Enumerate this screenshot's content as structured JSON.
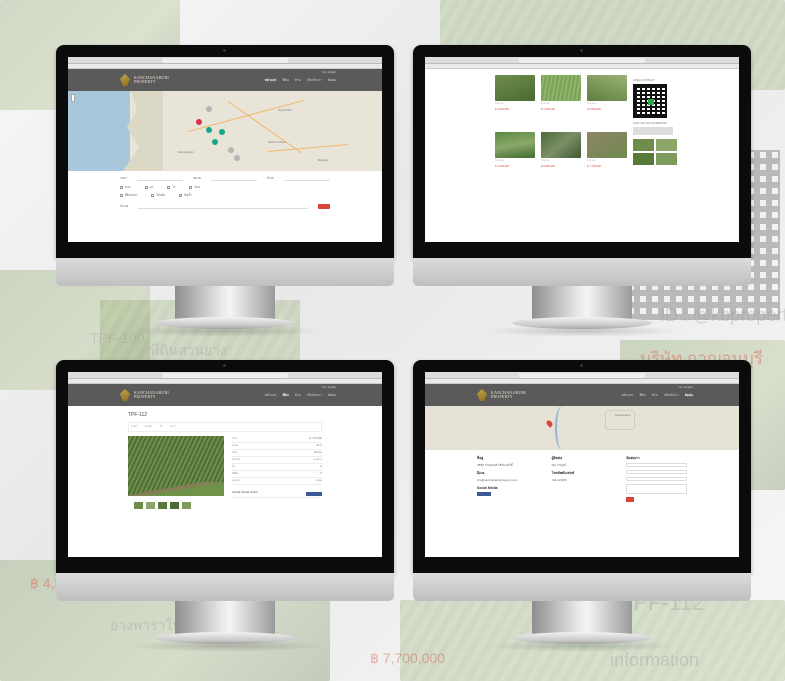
{
  "site": {
    "logo_line1": "KANCHANABURI",
    "logo_line2": "PROPERTY",
    "lang": "ไทย | English",
    "nav": [
      "หน้าแรก",
      "ที่ดิน",
      "บ้าน",
      "เกี่ยวกับเรา",
      "ติดต่อ"
    ]
  },
  "screen1": {
    "cities": [
      "Kanchanaburi",
      "Suphan Buri",
      "Nakhon Pathom",
      "Bangkok"
    ],
    "form_checks": [
      "สวน",
      "นา",
      "ไร่",
      "บ้าน",
      "ที่ดินเปล่า",
      "รีสอร์ท",
      "ติดน้ำ"
    ],
    "form_fields": [
      "ราคา",
      "ขนาด",
      "ทำเล",
      "อำเภอ"
    ]
  },
  "screen2": {
    "line_label": "LINE CONTACT",
    "fb_label": "LIKE US ON FACEBOOK",
    "listings": [
      {
        "price": "฿ 4,500,000",
        "tag": "TPF-101"
      },
      {
        "price": "฿ 2,300,000",
        "tag": "TPF-102"
      },
      {
        "price": "฿ 6,800,000",
        "tag": "TPF-103"
      },
      {
        "price": "฿ 3,200,000",
        "tag": "TPF-104"
      },
      {
        "price": "฿ 5,900,000",
        "tag": "TPF-105"
      },
      {
        "price": "฿ 7,700,000",
        "tag": "TPF-106"
      }
    ]
  },
  "screen3": {
    "title": "TPF-112",
    "bar": [
      "ราคา",
      "ขนาด",
      "ไร่",
      "ตร.ว."
    ],
    "share_label": "Social Media Share",
    "specs": [
      [
        "ราคา",
        "฿ 7,700,000"
      ],
      [
        "ขนาด",
        "32 ไร่"
      ],
      [
        "ทำเล",
        "ติดถนน"
      ],
      [
        "ประเภท",
        "สวนยาง"
      ],
      [
        "น้ำ",
        "มี"
      ],
      [
        "ไฟฟ้า",
        "มี"
      ],
      [
        "เอกสาร",
        "โฉนด"
      ]
    ]
  },
  "screen4": {
    "map_label": "Kanchanaburi",
    "col1_title": "ที่อยู่",
    "col1_text": "บริษัท กาญจนบุรี พร็อพเพอร์ตี้",
    "col1b_title": "อีเมล",
    "col1b_text": "info@kanchanaburiproperty.com",
    "col1c_title": "Social Media",
    "col2_title": "ผู้ติดต่อ",
    "col2_text": "คุณ กาญจน์",
    "col2b_title": "โทรศัพท์/แฟกซ์",
    "col2b_text": "034-123456",
    "col3_title": "ติดต่อเรา",
    "fields": [
      "ชื่อ",
      "อีเมล",
      "หัวข้อ",
      "ข้อความ"
    ]
  },
  "background": {
    "texts": [
      "TPF-100",
      "ที่ดินสวนยาง",
      "฿ 4,500,000",
      "ID : @kbproperty",
      "บริษัท กาญจนบุรี",
      "฿ 7,700,000",
      "information",
      "ยางพาราใหม่",
      "TPF-112"
    ]
  }
}
